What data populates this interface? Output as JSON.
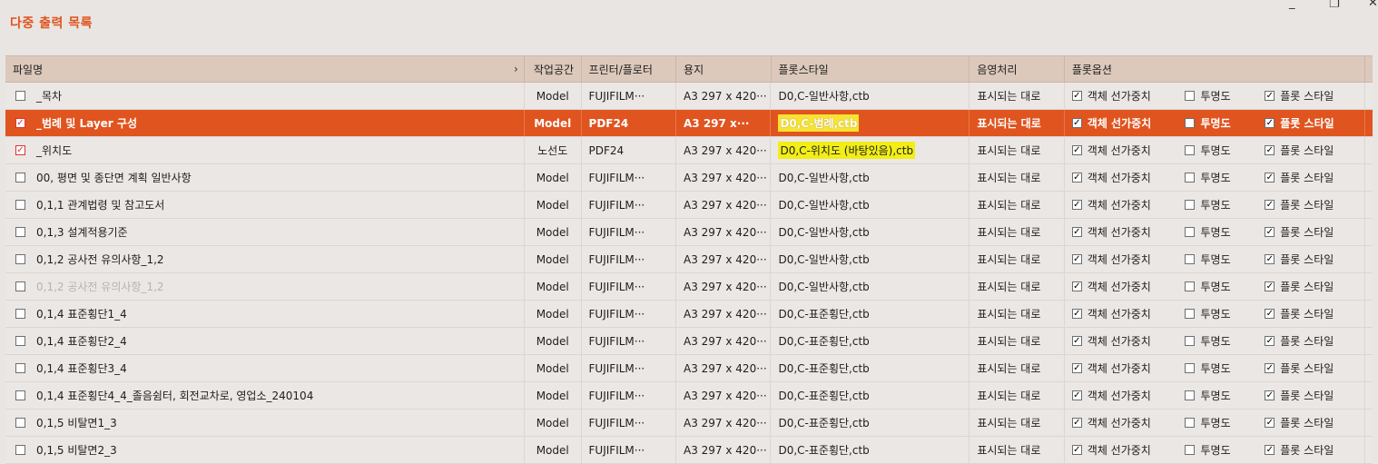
{
  "window": {
    "title": "다중 출력 목록",
    "restore_glyph": "❐",
    "close_glyph": "✕"
  },
  "columns": [
    "파일명",
    "작업공간",
    "프린터/플로터",
    "용지",
    "플롯스타일",
    "음영처리",
    "플롯옵션"
  ],
  "header_arrow": "›",
  "option_labels": {
    "lineweight": "객체 선가중치",
    "transparency": "투명도",
    "plotstyle": "플롯 스타일"
  },
  "rows": [
    {
      "name": "_목차",
      "checked": false,
      "work": "Model",
      "printer": "FUJIFILM···",
      "paper": "A3 297 x 420···",
      "style": "D0,C-일반사항,ctb",
      "shade": "표시되는 대로",
      "lw": true,
      "tr": false,
      "ps": true,
      "state": "normal",
      "highlight": false
    },
    {
      "name": "_범례 및 Layer 구성",
      "checked": true,
      "work": "Model",
      "printer": "PDF24",
      "paper": "A3 297 x···",
      "style": "D0,C-범례,ctb",
      "shade": "표시되는 대로",
      "lw": true,
      "tr": false,
      "ps": true,
      "state": "selected",
      "highlight": true
    },
    {
      "name": "_위치도",
      "checked": true,
      "work": "노선도",
      "printer": "PDF24",
      "paper": "A3 297 x 420···",
      "style": "D0,C-위치도 (바탕있음),ctb",
      "shade": "표시되는 대로",
      "lw": true,
      "tr": false,
      "ps": true,
      "state": "normal",
      "highlight": true
    },
    {
      "name": "00, 평면 및 종단면 계획 일반사항",
      "checked": false,
      "work": "Model",
      "printer": "FUJIFILM···",
      "paper": "A3 297 x 420···",
      "style": "D0,C-일반사항,ctb",
      "shade": "표시되는 대로",
      "lw": true,
      "tr": false,
      "ps": true,
      "state": "normal",
      "highlight": false
    },
    {
      "name": "0,1,1 관계법령 및 참고도서",
      "checked": false,
      "work": "Model",
      "printer": "FUJIFILM···",
      "paper": "A3 297 x 420···",
      "style": "D0,C-일반사항,ctb",
      "shade": "표시되는 대로",
      "lw": true,
      "tr": false,
      "ps": true,
      "state": "normal",
      "highlight": false
    },
    {
      "name": "0,1,3 설계적용기준",
      "checked": false,
      "work": "Model",
      "printer": "FUJIFILM···",
      "paper": "A3 297 x 420···",
      "style": "D0,C-일반사항,ctb",
      "shade": "표시되는 대로",
      "lw": true,
      "tr": false,
      "ps": true,
      "state": "normal",
      "highlight": false
    },
    {
      "name": "0,1,2 공사전 유의사항_1,2",
      "checked": false,
      "work": "Model",
      "printer": "FUJIFILM···",
      "paper": "A3 297 x 420···",
      "style": "D0,C-일반사항,ctb",
      "shade": "표시되는 대로",
      "lw": true,
      "tr": false,
      "ps": true,
      "state": "normal",
      "highlight": false
    },
    {
      "name": "0,1,2 공사전 유의사항_1,2",
      "checked": false,
      "work": "Model",
      "printer": "FUJIFILM···",
      "paper": "A3 297 x 420···",
      "style": "D0,C-일반사항,ctb",
      "shade": "표시되는 대로",
      "lw": true,
      "tr": false,
      "ps": true,
      "state": "faded",
      "highlight": false
    },
    {
      "name": "0,1,4 표준횡단1_4",
      "checked": false,
      "work": "Model",
      "printer": "FUJIFILM···",
      "paper": "A3 297 x 420···",
      "style": "D0,C-표준횡단,ctb",
      "shade": "표시되는 대로",
      "lw": true,
      "tr": false,
      "ps": true,
      "state": "normal",
      "highlight": false
    },
    {
      "name": "0,1,4 표준횡단2_4",
      "checked": false,
      "work": "Model",
      "printer": "FUJIFILM···",
      "paper": "A3 297 x 420···",
      "style": "D0,C-표준횡단,ctb",
      "shade": "표시되는 대로",
      "lw": true,
      "tr": false,
      "ps": true,
      "state": "normal",
      "highlight": false
    },
    {
      "name": "0,1,4 표준횡단3_4",
      "checked": false,
      "work": "Model",
      "printer": "FUJIFILM···",
      "paper": "A3 297 x 420···",
      "style": "D0,C-표준횡단,ctb",
      "shade": "표시되는 대로",
      "lw": true,
      "tr": false,
      "ps": true,
      "state": "normal",
      "highlight": false
    },
    {
      "name": "0,1,4 표준횡단4_4_졸음쉼터, 회전교차로, 영업소_240104",
      "checked": false,
      "work": "Model",
      "printer": "FUJIFILM···",
      "paper": "A3 297 x 420···",
      "style": "D0,C-표준횡단,ctb",
      "shade": "표시되는 대로",
      "lw": true,
      "tr": false,
      "ps": true,
      "state": "normal",
      "highlight": false
    },
    {
      "name": "0,1,5 비탈면1_3",
      "checked": false,
      "work": "Model",
      "printer": "FUJIFILM···",
      "paper": "A3 297 x 420···",
      "style": "D0,C-표준횡단,ctb",
      "shade": "표시되는 대로",
      "lw": true,
      "tr": false,
      "ps": true,
      "state": "normal",
      "highlight": false
    },
    {
      "name": "0,1,5 비탈면2_3",
      "checked": false,
      "work": "Model",
      "printer": "FUJIFILM···",
      "paper": "A3 297 x 420···",
      "style": "D0,C-표준횡단,ctb",
      "shade": "표시되는 대로",
      "lw": true,
      "tr": false,
      "ps": true,
      "state": "normal",
      "highlight": false
    }
  ]
}
